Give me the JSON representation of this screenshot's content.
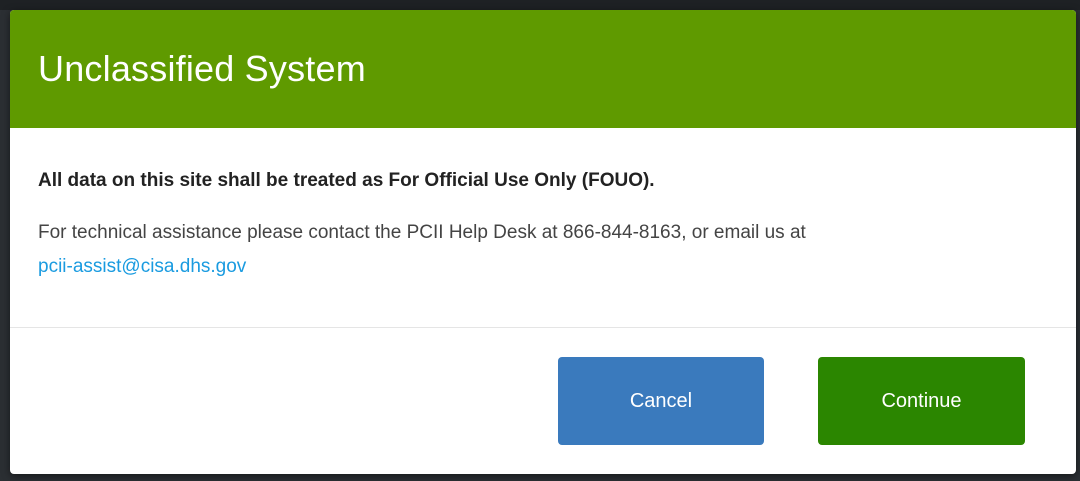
{
  "dialog": {
    "title": "Unclassified System",
    "notice": "All data on this site shall be treated as For Official Use Only (FOUO).",
    "help_text": "For technical assistance please contact the PCII Help Desk at 866-844-8163, or email us at",
    "email": "pcii-assist@cisa.dhs.gov"
  },
  "buttons": {
    "cancel_label": "Cancel",
    "continue_label": "Continue"
  },
  "colors": {
    "header": "#5f9a00",
    "cancel": "#3a7abd",
    "continue": "#2b8600",
    "link": "#1a9be0"
  }
}
